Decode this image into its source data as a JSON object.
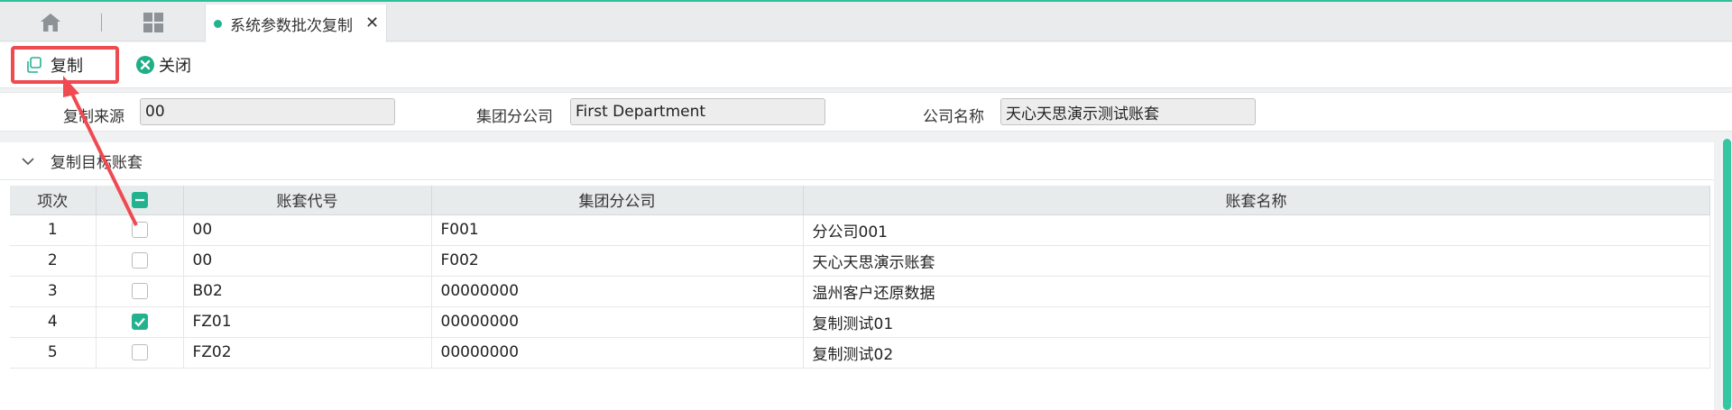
{
  "tabs": {
    "home_icon": "home-icon",
    "grid_icon": "grid-icon",
    "active_tab_label": "系统参数批次复制",
    "close_glyph": "✕"
  },
  "toolbar": {
    "copy_label": "复制",
    "close_label": "关闭"
  },
  "form": {
    "source_label": "复制来源",
    "source_value": "00",
    "group_label": "集团分公司",
    "group_value": "First Department",
    "company_label": "公司名称",
    "company_value": "天心天思演示测试账套"
  },
  "section": {
    "title": "复制目标账套"
  },
  "table": {
    "headers": {
      "index": "项次",
      "code": "账套代号",
      "group": "集团分公司",
      "name": "账套名称"
    },
    "rows": [
      {
        "index": "1",
        "checked": false,
        "code": "00",
        "group": "F001",
        "name": "分公司001"
      },
      {
        "index": "2",
        "checked": false,
        "code": "00",
        "group": "F002",
        "name": "天心天思演示账套"
      },
      {
        "index": "3",
        "checked": false,
        "code": "B02",
        "group": "00000000",
        "name": "温州客户还原数据"
      },
      {
        "index": "4",
        "checked": true,
        "code": "FZ01",
        "group": "00000000",
        "name": "复制测试01"
      },
      {
        "index": "5",
        "checked": false,
        "code": "FZ02",
        "group": "00000000",
        "name": "复制测试02"
      }
    ]
  },
  "colors": {
    "accent": "#22b38e",
    "highlight": "#ef4a51"
  }
}
